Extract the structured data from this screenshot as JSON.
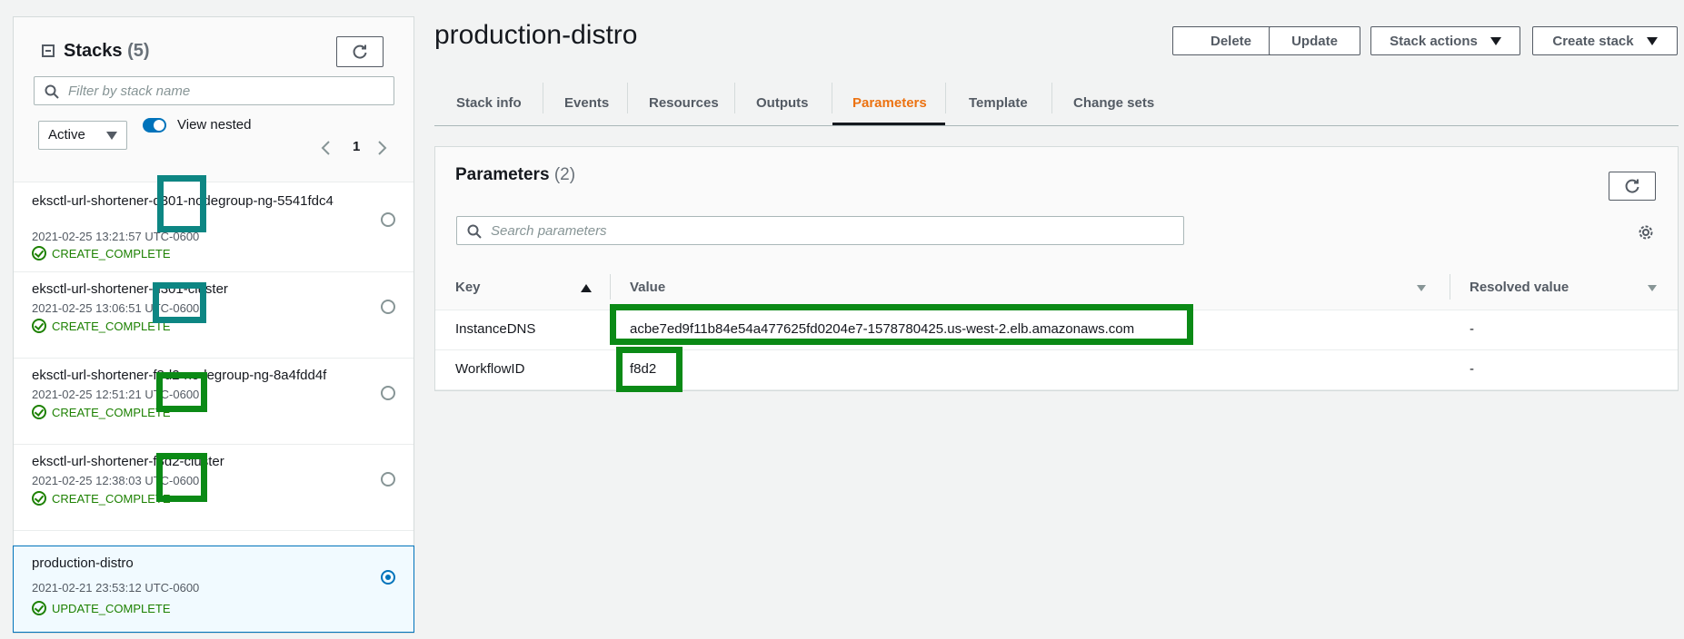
{
  "sidebar": {
    "title": "Stacks",
    "count": "(5)",
    "filter_placeholder": "Filter by stack name",
    "status_filter": "Active",
    "view_nested_label": "View nested",
    "page": "1",
    "stacks": [
      {
        "name": "eksctl-url-shortener-d301-nodegroup-ng-5541fdc4",
        "time": "2021-02-25 13:21:57 UTC-0600",
        "status": "CREATE_COMPLETE"
      },
      {
        "name": "eksctl-url-shortener-d301-cluster",
        "time": "2021-02-25 13:06:51 UTC-0600",
        "status": "CREATE_COMPLETE"
      },
      {
        "name": "eksctl-url-shortener-f8d2-nodegroup-ng-8a4fdd4f",
        "time": "2021-02-25 12:51:21 UTC-0600",
        "status": "CREATE_COMPLETE"
      },
      {
        "name": "eksctl-url-shortener-f8d2-cluster",
        "time": "2021-02-25 12:38:03 UTC-0600",
        "status": "CREATE_COMPLETE"
      },
      {
        "name": "production-distro",
        "time": "2021-02-21 23:53:12 UTC-0600",
        "status": "UPDATE_COMPLETE"
      }
    ]
  },
  "header": {
    "title": "production-distro",
    "buttons": {
      "delete": "Delete",
      "update": "Update",
      "stack_actions": "Stack actions",
      "create_stack": "Create stack"
    }
  },
  "tabs": [
    "Stack info",
    "Events",
    "Resources",
    "Outputs",
    "Parameters",
    "Template",
    "Change sets"
  ],
  "active_tab": "Parameters",
  "parameters": {
    "title": "Parameters",
    "count": "(2)",
    "search_placeholder": "Search parameters",
    "columns": {
      "key": "Key",
      "value": "Value",
      "resolved": "Resolved value"
    },
    "rows": [
      {
        "key": "InstanceDNS",
        "value": "acbe7ed9f11b84e54a477625fd0204e7-1578780425.us-west-2.elb.amazonaws.com",
        "resolved": "-"
      },
      {
        "key": "WorkflowID",
        "value": "f8d2",
        "resolved": "-"
      }
    ]
  },
  "colors": {
    "accent": "#0073bb",
    "active_tab": "#ec7211",
    "success": "#1d8102",
    "highlight_green": "#0b8a16",
    "highlight_teal": "#0d8683"
  }
}
